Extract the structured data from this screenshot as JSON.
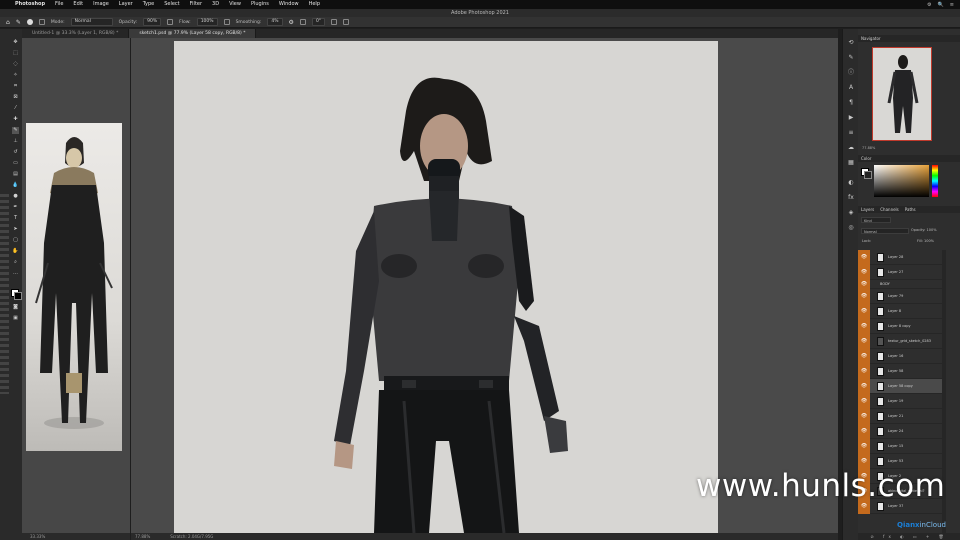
{
  "menubar": {
    "apple": "",
    "items": [
      "Photoshop",
      "File",
      "Edit",
      "Image",
      "Layer",
      "Type",
      "Select",
      "Filter",
      "3D",
      "View",
      "Plugins",
      "Window",
      "Help"
    ],
    "right": [
      "⚙",
      "🔍",
      "≡"
    ]
  },
  "window": {
    "title": "Adobe Photoshop 2021"
  },
  "options": {
    "mode_label": "Mode:",
    "mode_value": "Normal",
    "opacity_label": "Opacity:",
    "opacity_value": "90%",
    "flow_label": "Flow:",
    "flow_value": "100%",
    "smoothing_label": "Smoothing:",
    "smoothing_value": "4%",
    "angle_value": "0°"
  },
  "tabs": [
    {
      "label": "Untitled-1 @ 33.3% (Layer 1, RGB/8) *",
      "active": false
    },
    {
      "label": "sketch1.psd @ 77.9% (Layer 58 copy, RGB/8) *",
      "active": true
    }
  ],
  "status": {
    "left_zoom": "33.33%",
    "main_zoom": "77.88%",
    "main_doc": "Scratch: 2.04G/7.95G"
  },
  "panels": {
    "navigator_tab": "Navigator",
    "navigator_zoom": "77.88%",
    "color_tab": "Color",
    "layers_tabs": [
      "Layers",
      "Channels",
      "Paths"
    ],
    "kind_label": "Kind",
    "blend_mode": "Normal",
    "opacity_label": "Opacity:",
    "opacity_value": "100%",
    "lock_label": "Lock:",
    "fill_label": "Fill:",
    "fill_value": "100%"
  },
  "layers": [
    "Layer 28",
    "Layer 27",
    "BODY",
    "Layer 79",
    "Layer 8",
    "Layer 8 copy",
    "textur_grid_sketch_0283",
    "Layer 16",
    "Layer 58",
    "Layer 58 copy",
    "Layer 19",
    "Layer 21",
    "Layer 24",
    "Layer 15",
    "Layer 53",
    "Layer 2",
    "akindigital_material?",
    "Layer 37"
  ],
  "watermark": {
    "text": "www.hunls.com"
  },
  "cloud": {
    "part1": "Qianx",
    "part2": "inCloud"
  },
  "colors": {
    "layer_eye": "#c46a1d",
    "panel_bg": "#2e2e2e",
    "canvas_bg": "#d7d6d3"
  }
}
